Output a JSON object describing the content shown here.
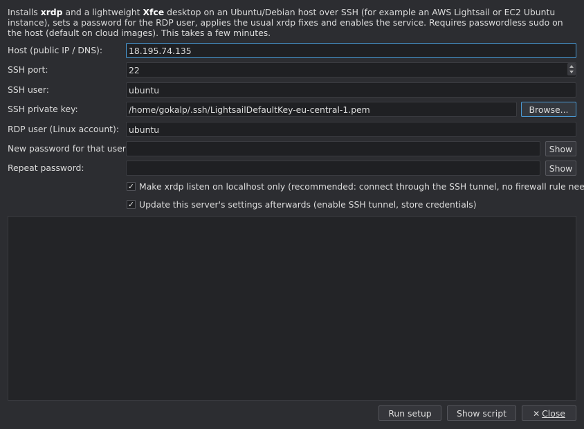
{
  "description": {
    "pre": "Installs ",
    "b1": "xrdp",
    "mid": " and a lightweight ",
    "b2": "Xfce",
    "post": " desktop on an Ubuntu/Debian host over SSH (for example an AWS Lightsail or EC2 Ubuntu instance), sets a password for the RDP user, applies the usual xrdp fixes and enables the service. Requires passwordless sudo on the host (default on cloud images). This takes a few minutes."
  },
  "form": {
    "host": {
      "label": "Host (public IP / DNS):",
      "value": "18.195.74.135"
    },
    "port": {
      "label": "SSH port:",
      "value": "22"
    },
    "user": {
      "label": "SSH user:",
      "value": "ubuntu"
    },
    "key": {
      "label": "SSH private key:",
      "value": "/home/gokalp/.ssh/LightsailDefaultKey-eu-central-1.pem",
      "browse": "Browse..."
    },
    "rdp_user": {
      "label": "RDP user (Linux account):",
      "value": "ubuntu"
    },
    "new_password": {
      "label": "New password for that user:",
      "value": "",
      "show": "Show"
    },
    "repeat_password": {
      "label": "Repeat password:",
      "value": "",
      "show": "Show"
    }
  },
  "options": {
    "localhost": {
      "label": "Make xrdp listen on localhost only (recommended: connect through the SSH tunnel, no firewall rule needed)",
      "checked": true
    },
    "update_settings": {
      "label": "Update this server's settings afterwards (enable SSH tunnel, store credentials)",
      "checked": true
    }
  },
  "buttons": {
    "run": "Run setup",
    "show_script": "Show script",
    "close_icon": "✕",
    "close": "Close"
  },
  "icons": {
    "checkmark": "✓"
  },
  "colors": {
    "background": "#2c2d31",
    "field": "#1f2023",
    "focus": "#4a9bd6"
  }
}
